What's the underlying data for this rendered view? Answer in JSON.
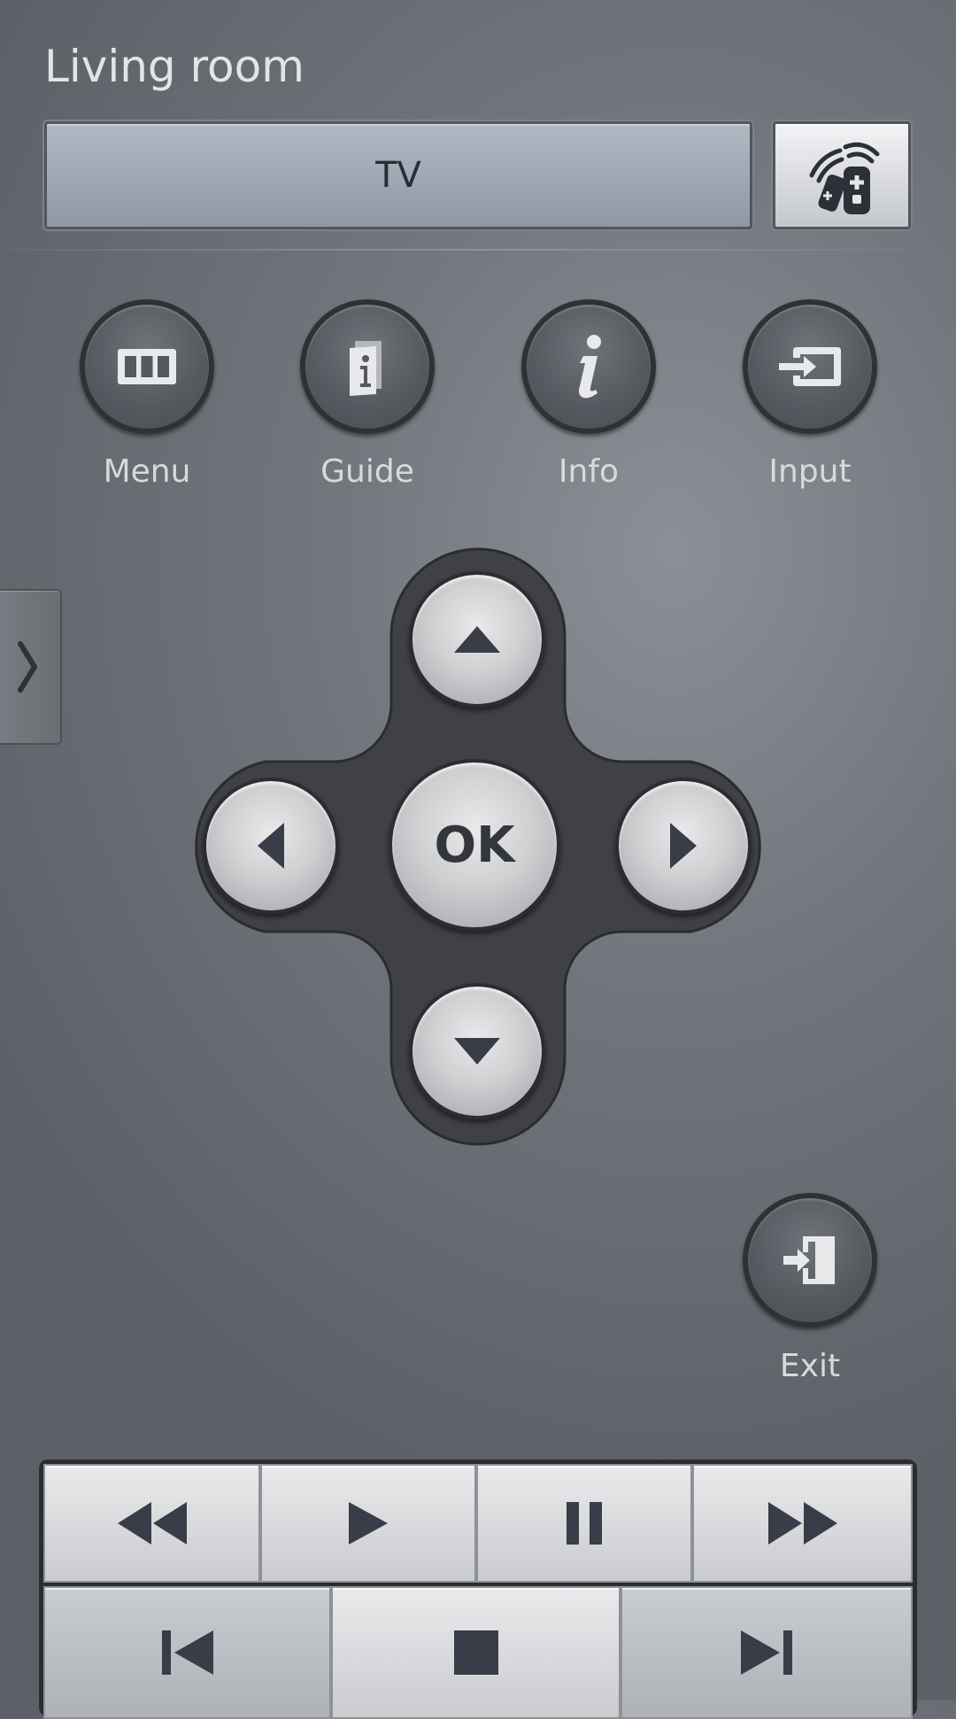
{
  "header": {
    "title": "Living room"
  },
  "device": {
    "label": "TV",
    "remote_icon": "multi-remote-icon"
  },
  "function_buttons": [
    {
      "label": "Menu",
      "icon": "menu-grid-icon"
    },
    {
      "label": "Guide",
      "icon": "guide-book-icon"
    },
    {
      "label": "Info",
      "icon": "info-icon"
    },
    {
      "label": "Input",
      "icon": "input-source-icon"
    }
  ],
  "dpad": {
    "ok_label": "OK"
  },
  "exit": {
    "label": "Exit",
    "icon": "exit-door-icon"
  },
  "side_panel": {
    "icon": "chevron-right-icon"
  },
  "media_controls": {
    "row1": [
      "rewind-icon",
      "play-icon",
      "pause-icon",
      "fast-forward-icon"
    ],
    "row2": [
      "skip-previous-icon",
      "stop-icon",
      "skip-next-icon"
    ]
  },
  "colors": {
    "icon_dark": "#3a3d47",
    "label_light": "#d8d9dc"
  }
}
